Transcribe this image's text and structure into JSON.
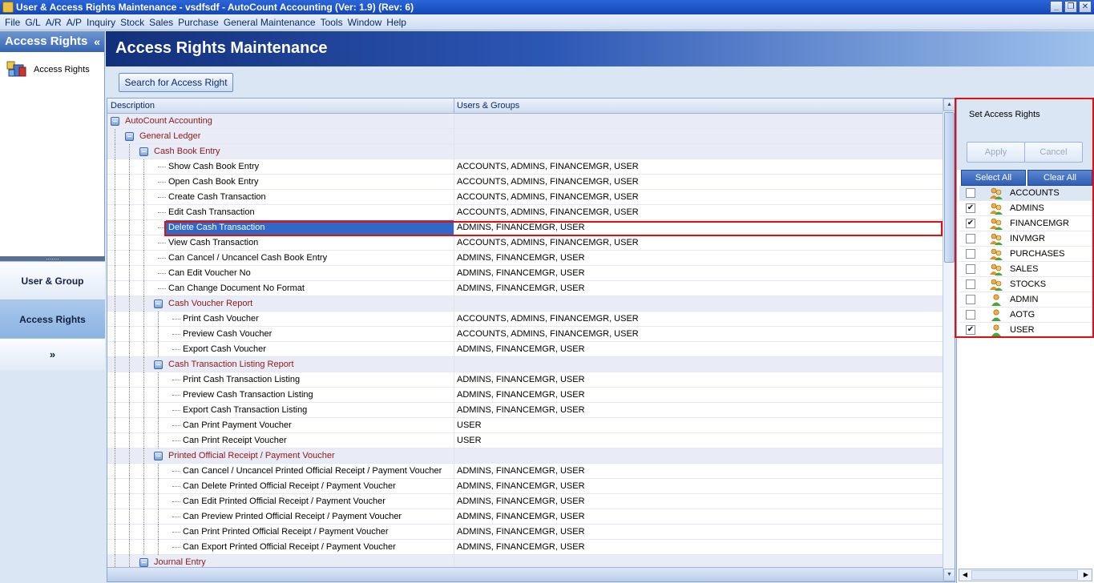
{
  "window": {
    "title": "User & Access Rights Maintenance - vsdfsdf - AutoCount Accounting (Ver: 1.9) (Rev: 6)"
  },
  "menu": [
    "File",
    "G/L",
    "A/R",
    "A/P",
    "Inquiry",
    "Stock",
    "Sales",
    "Purchase",
    "General Maintenance",
    "Tools",
    "Window",
    "Help"
  ],
  "left_panel": {
    "header": "Access Rights",
    "collapse_glyph": "«",
    "item": "Access Rights",
    "splitter": "․․․․․․․",
    "nav": [
      "User & Group",
      "Access Rights"
    ],
    "more_glyph": "»"
  },
  "main": {
    "title": "Access Rights Maintenance",
    "search_button": "Search for Access Right",
    "columns": [
      "Description",
      "Users & Groups"
    ]
  },
  "tree": [
    {
      "label": "AutoCount Accounting",
      "users": "",
      "group": true,
      "level": 0
    },
    {
      "label": "General Ledger",
      "users": "",
      "group": true,
      "level": 1
    },
    {
      "label": "Cash Book Entry",
      "users": "",
      "group": true,
      "level": 2
    },
    {
      "label": "Show Cash Book Entry",
      "users": "ACCOUNTS, ADMINS, FINANCEMGR, USER",
      "level": 3
    },
    {
      "label": "Open Cash Book Entry",
      "users": "ACCOUNTS, ADMINS, FINANCEMGR, USER",
      "level": 3
    },
    {
      "label": "Create Cash Transaction",
      "users": "ACCOUNTS, ADMINS, FINANCEMGR, USER",
      "level": 3
    },
    {
      "label": "Edit Cash Transaction",
      "users": "ACCOUNTS, ADMINS, FINANCEMGR, USER",
      "level": 3
    },
    {
      "label": "Delete Cash Transaction",
      "users": "ADMINS, FINANCEMGR, USER",
      "level": 3,
      "selected": true
    },
    {
      "label": "View Cash Transaction",
      "users": "ACCOUNTS, ADMINS, FINANCEMGR, USER",
      "level": 3
    },
    {
      "label": "Can Cancel / Uncancel Cash Book Entry",
      "users": "ADMINS, FINANCEMGR, USER",
      "level": 3
    },
    {
      "label": "Can Edit Voucher No",
      "users": "ADMINS, FINANCEMGR, USER",
      "level": 3
    },
    {
      "label": "Can Change Document No Format",
      "users": "ADMINS, FINANCEMGR, USER",
      "level": 3
    },
    {
      "label": "Cash Voucher Report",
      "users": "",
      "group": true,
      "level": 3
    },
    {
      "label": "Print Cash Voucher",
      "users": "ACCOUNTS, ADMINS, FINANCEMGR, USER",
      "level": 4
    },
    {
      "label": "Preview Cash Voucher",
      "users": "ACCOUNTS, ADMINS, FINANCEMGR, USER",
      "level": 4
    },
    {
      "label": "Export Cash Voucher",
      "users": "ADMINS, FINANCEMGR, USER",
      "level": 4
    },
    {
      "label": "Cash Transaction Listing Report",
      "users": "",
      "group": true,
      "level": 3
    },
    {
      "label": "Print Cash Transaction Listing",
      "users": "ADMINS, FINANCEMGR, USER",
      "level": 4
    },
    {
      "label": "Preview Cash Transaction Listing",
      "users": "ADMINS, FINANCEMGR, USER",
      "level": 4
    },
    {
      "label": "Export Cash Transaction Listing",
      "users": "ADMINS, FINANCEMGR, USER",
      "level": 4
    },
    {
      "label": "Can Print Payment Voucher",
      "users": "USER",
      "level": 4
    },
    {
      "label": "Can Print Receipt Voucher",
      "users": "USER",
      "level": 4
    },
    {
      "label": "Printed Official Receipt / Payment Voucher",
      "users": "",
      "group": true,
      "level": 3
    },
    {
      "label": "Can Cancel / Uncancel Printed Official Receipt / Payment Voucher",
      "users": "ADMINS, FINANCEMGR, USER",
      "level": 4
    },
    {
      "label": "Can Delete Printed Official Receipt / Payment Voucher",
      "users": "ADMINS, FINANCEMGR, USER",
      "level": 4
    },
    {
      "label": "Can Edit Printed Official Receipt / Payment Voucher",
      "users": "ADMINS, FINANCEMGR, USER",
      "level": 4
    },
    {
      "label": "Can Preview Printed Official Receipt / Payment Voucher",
      "users": "ADMINS, FINANCEMGR, USER",
      "level": 4
    },
    {
      "label": "Can Print Printed Official Receipt / Payment Voucher",
      "users": "ADMINS, FINANCEMGR, USER",
      "level": 4
    },
    {
      "label": "Can Export Printed Official Receipt / Payment Voucher",
      "users": "ADMINS, FINANCEMGR, USER",
      "level": 4
    },
    {
      "label": "Journal Entry",
      "users": "",
      "group": true,
      "level": 2
    }
  ],
  "right_panel": {
    "title": "Set Access Rights",
    "apply": "Apply",
    "cancel": "Cancel",
    "select_all": "Select All",
    "clear_all": "Clear All",
    "groups": [
      {
        "name": "ACCOUNTS",
        "checked": false,
        "icon": "users-group-icon"
      },
      {
        "name": "ADMINS",
        "checked": true,
        "icon": "users-group-icon"
      },
      {
        "name": "FINANCEMGR",
        "checked": true,
        "icon": "users-group-icon"
      },
      {
        "name": "INVMGR",
        "checked": false,
        "icon": "users-group-icon"
      },
      {
        "name": "PURCHASES",
        "checked": false,
        "icon": "users-group-icon"
      },
      {
        "name": "SALES",
        "checked": false,
        "icon": "users-group-icon"
      },
      {
        "name": "STOCKS",
        "checked": false,
        "icon": "users-group-icon"
      },
      {
        "name": "ADMIN",
        "checked": false,
        "icon": "single-user-icon"
      },
      {
        "name": "AOTG",
        "checked": false,
        "icon": "single-user-icon"
      },
      {
        "name": "USER",
        "checked": true,
        "icon": "single-user-icon"
      }
    ]
  },
  "colors": {
    "selection": "#3168c8",
    "highlight_border": "#e01010",
    "group_text": "#8b1a1a"
  }
}
